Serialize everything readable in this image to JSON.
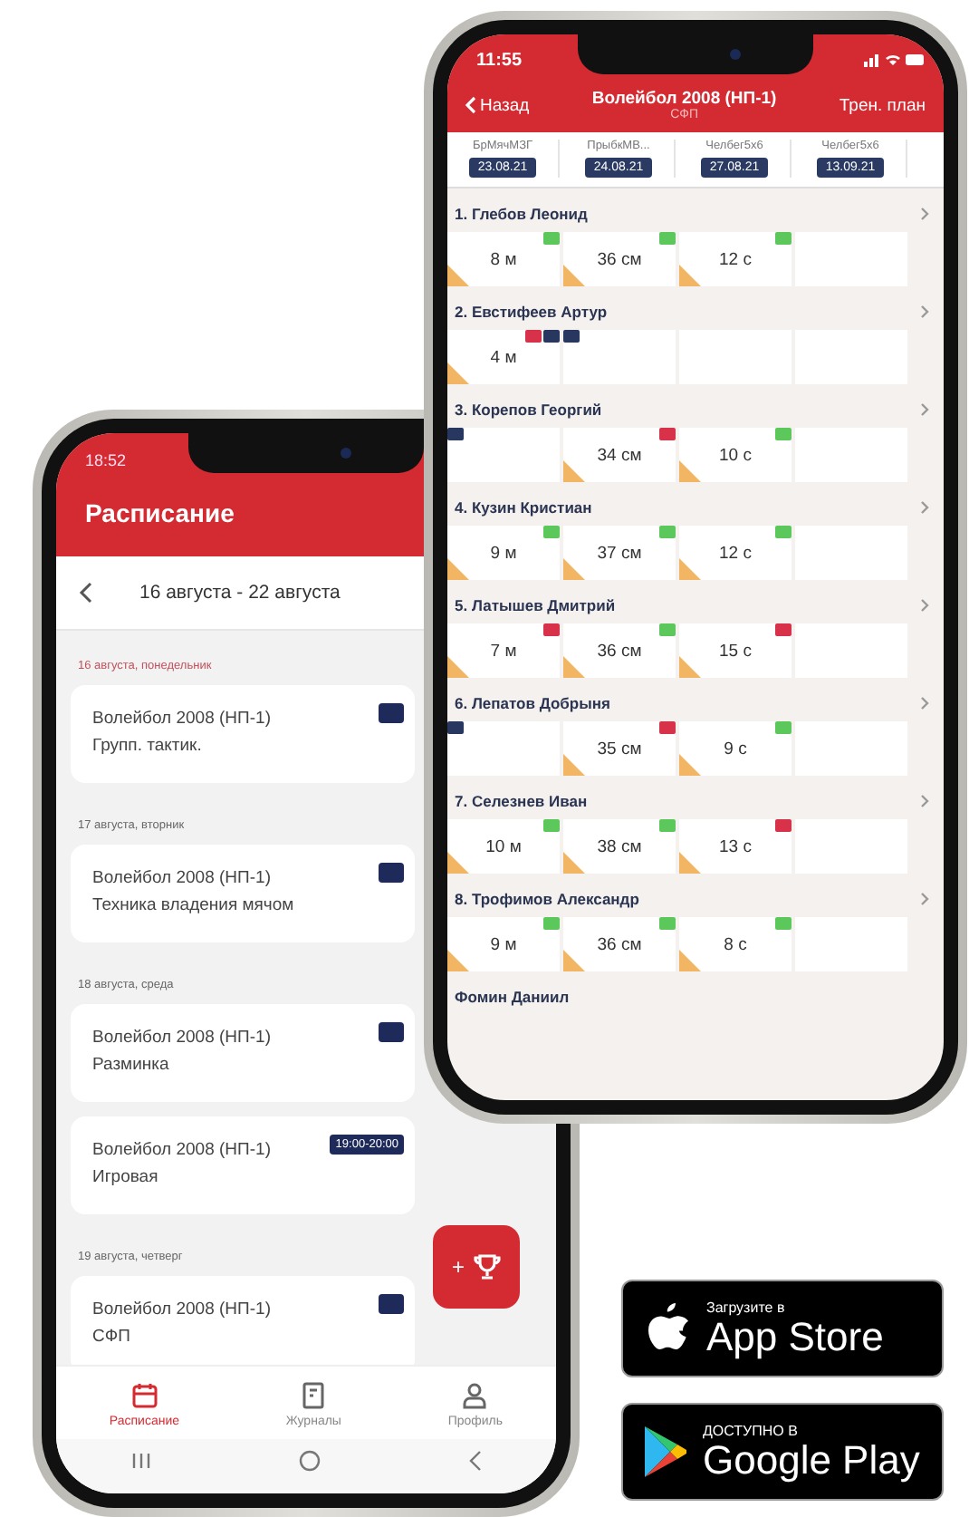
{
  "schedule_phone": {
    "status_time": "18:52",
    "title": "Расписание",
    "week": "16 августа - 22 августа",
    "days": [
      {
        "date": "16 августа, понедельник",
        "events": [
          {
            "team": "Волейбол 2008 (НП-1)",
            "activity": "Групп. тактик.",
            "time_badge": true
          }
        ]
      },
      {
        "date": "17 августа, вторник",
        "events": [
          {
            "team": "Волейбол 2008 (НП-1)",
            "activity": "Техника владения мячом",
            "time_badge": true
          }
        ]
      },
      {
        "date": "18 августа, среда",
        "events": [
          {
            "team": "Волейбол 2008 (НП-1)",
            "activity": "Разминка",
            "time_badge": true
          },
          {
            "team": "Волейбол 2008 (НП-1)",
            "activity": "Игровая",
            "time_badge": true,
            "time": "19:00-20:00"
          }
        ]
      },
      {
        "date": "19 августа, четверг",
        "events": [
          {
            "team": "Волейбол 2008 (НП-1)",
            "activity": "СФП",
            "time_badge": true
          }
        ]
      }
    ],
    "fab": "+",
    "tabs": [
      {
        "label": "Расписание",
        "selected": true
      },
      {
        "label": "Журналы",
        "selected": false
      },
      {
        "label": "Профиль",
        "selected": false
      }
    ]
  },
  "results_phone": {
    "status_time": "11:55",
    "back": "Назад",
    "title": "Волейбол 2008 (НП-1)",
    "subtitle": "СФП",
    "action": "Трен. план",
    "columns": [
      {
        "label": "БрМячМЗГ",
        "date": "23.08.21"
      },
      {
        "label": "ПрыбкМВ...",
        "date": "24.08.21"
      },
      {
        "label": "Челбег5х6",
        "date": "27.08.21"
      },
      {
        "label": "Челбег5х6",
        "date": "13.09.21"
      }
    ],
    "athletes": [
      {
        "name": "1. Глебов Леонид",
        "cells": [
          {
            "value": "8 м",
            "corner": true,
            "badges": [
              {
                "color": "#5cc85c"
              }
            ]
          },
          {
            "value": "36 см",
            "corner": true,
            "badges": [
              {
                "color": "#5cc85c"
              }
            ]
          },
          {
            "value": "12 с",
            "corner": true,
            "badges": [
              {
                "color": "#5cc85c"
              }
            ]
          },
          {
            "corner": false
          }
        ]
      },
      {
        "name": "2. Евстифеев Артур",
        "cells": [
          {
            "value": "4 м",
            "corner": true,
            "badges": [
              {
                "color": "#d8324a"
              },
              {
                "color": "#27375f"
              }
            ]
          },
          {
            "corner": false,
            "badges": [
              {
                "color": "#27375f"
              }
            ]
          },
          {
            "corner": false
          },
          {
            "corner": false
          }
        ]
      },
      {
        "name": "3. Корепов Георгий",
        "cells": [
          {
            "corner": false,
            "badges": [
              {
                "color": "#27375f"
              }
            ]
          },
          {
            "value": "34 см",
            "corner": true,
            "badges": [
              {
                "color": "#d8324a"
              }
            ]
          },
          {
            "value": "10 с",
            "corner": true,
            "badges": [
              {
                "color": "#5cc85c"
              }
            ]
          },
          {
            "corner": false
          }
        ]
      },
      {
        "name": "4. Кузин Кристиан",
        "cells": [
          {
            "value": "9 м",
            "corner": true,
            "badges": [
              {
                "color": "#5cc85c"
              }
            ]
          },
          {
            "value": "37 см",
            "corner": true,
            "badges": [
              {
                "color": "#5cc85c"
              }
            ]
          },
          {
            "value": "12 с",
            "corner": true,
            "badges": [
              {
                "color": "#5cc85c"
              }
            ]
          },
          {
            "corner": false
          }
        ]
      },
      {
        "name": "5. Латышев Дмитрий",
        "cells": [
          {
            "value": "7 м",
            "corner": true,
            "badges": [
              {
                "color": "#d8324a"
              }
            ]
          },
          {
            "value": "36 см",
            "corner": true,
            "badges": [
              {
                "color": "#5cc85c"
              }
            ]
          },
          {
            "value": "15 с",
            "corner": true,
            "badges": [
              {
                "color": "#d8324a"
              }
            ]
          },
          {
            "corner": false
          }
        ]
      },
      {
        "name": "6. Лепатов Добрыня",
        "cells": [
          {
            "corner": false,
            "badges": [
              {
                "color": "#27375f"
              }
            ]
          },
          {
            "value": "35 см",
            "corner": true,
            "badges": [
              {
                "color": "#d8324a"
              }
            ]
          },
          {
            "value": "9 с",
            "corner": true,
            "badges": [
              {
                "color": "#5cc85c"
              }
            ]
          },
          {
            "corner": false
          }
        ]
      },
      {
        "name": "7. Селезнев Иван",
        "cells": [
          {
            "value": "10 м",
            "corner": true,
            "badges": [
              {
                "color": "#5cc85c"
              }
            ]
          },
          {
            "value": "38 см",
            "corner": true,
            "badges": [
              {
                "color": "#5cc85c"
              }
            ]
          },
          {
            "value": "13 с",
            "corner": true,
            "badges": [
              {
                "color": "#d8324a"
              }
            ]
          },
          {
            "corner": false
          }
        ]
      },
      {
        "name": "8. Трофимов Александр",
        "cells": [
          {
            "value": "9 м",
            "corner": true,
            "badges": [
              {
                "color": "#5cc85c"
              }
            ]
          },
          {
            "value": "36 см",
            "corner": true,
            "badges": [
              {
                "color": "#5cc85c"
              }
            ]
          },
          {
            "value": "8 с",
            "corner": true,
            "badges": [
              {
                "color": "#5cc85c"
              }
            ]
          },
          {
            "corner": false
          }
        ]
      },
      {
        "name": "Фомин Даниил"
      }
    ]
  },
  "store_badges": [
    {
      "kind": "apple",
      "caption": "Загрузите в",
      "name": "App Store"
    },
    {
      "kind": "google",
      "caption": "ДОСТУПНО В",
      "name": "Google Play"
    }
  ]
}
